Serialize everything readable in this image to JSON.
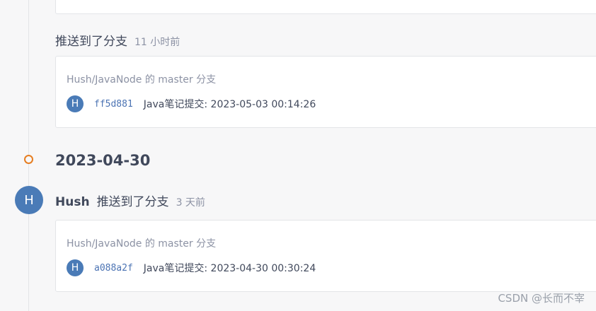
{
  "colors": {
    "avatar": "#4a7bb7",
    "hash_link": "#4b73b3",
    "date_dot": "#e67e22",
    "text_muted": "#8c92a4"
  },
  "events": [
    {
      "action": "推送到了分支",
      "time": "11 小时前",
      "branch": "Hush/JavaNode 的 master 分支",
      "commit": {
        "avatar_letter": "H",
        "hash": "ff5d881",
        "message": "Java笔记提交: 2023-05-03 00:14:26"
      }
    },
    {
      "user": "Hush",
      "avatar_letter": "H",
      "action": "推送到了分支",
      "time": "3 天前",
      "branch": "Hush/JavaNode 的 master 分支",
      "commit": {
        "avatar_letter": "H",
        "hash": "a088a2f",
        "message": "Java笔记提交: 2023-04-30 00:30:24"
      }
    }
  ],
  "date_group": "2023-04-30",
  "watermark": "CSDN @长而不宰"
}
